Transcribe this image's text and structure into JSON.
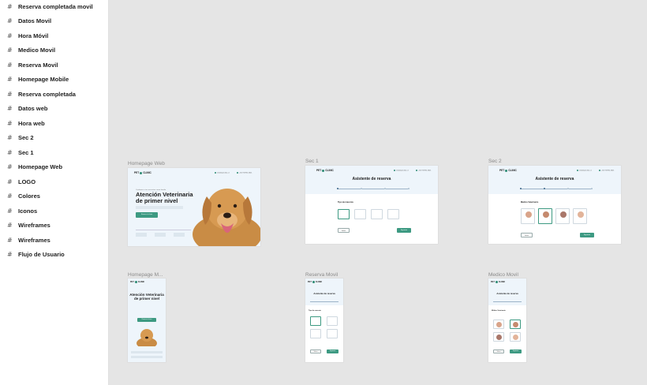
{
  "layers": [
    "Reserva completada movil",
    "Datos Movil",
    "Hora Móvil",
    "Medico Movil",
    "Reserva Movil",
    "Homepage Mobile",
    "Reserva completada",
    "Datos web",
    "Hora web",
    "Sec 2",
    "Sec 1",
    "Homepage Web",
    "LOGO",
    "Colores",
    "Iconos",
    "Wireframes",
    "Wireframes",
    "Flujo de Usuario"
  ],
  "frames": {
    "homepage_web": "Homepage Web",
    "sec1": "Sec 1",
    "sec2": "Sec 2",
    "homepage_mobile": "Homepage M...",
    "reserva_movil": "Reserva Movil",
    "medico_movil": "Medico Movil"
  },
  "mock": {
    "logo_left": "PET",
    "logo_right": "CLINIC",
    "email": "info@petclinic.cl",
    "phone": "+56 9 8765 4321",
    "hero_kicker": "Cuidamos a tus mascotas como familia",
    "hero_title": "Atención Veterinaria de primer nivel",
    "hero_button": "Reserva tu hora",
    "booking_title": "Asistente de reserva",
    "pet_type": "Tipo de mascota",
    "vet_title": "Médico Veterinario",
    "back_button": "Volver",
    "next_button": "Siguiente"
  },
  "icons": {
    "layer": "hash-frame-icon",
    "dog": "dog-photo"
  }
}
